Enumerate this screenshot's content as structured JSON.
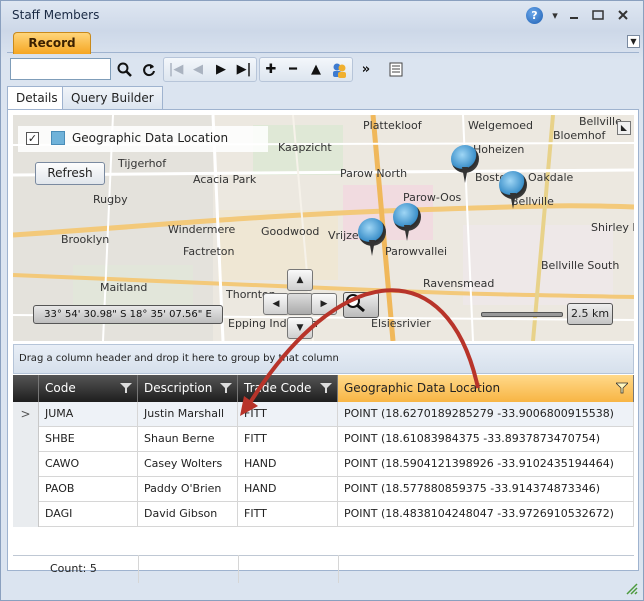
{
  "window": {
    "title": "Staff Members",
    "help_icon": "?"
  },
  "tabs": {
    "record_label": "Record"
  },
  "toolbar": {
    "search_value": ""
  },
  "subtabs": [
    {
      "label": "Details"
    },
    {
      "label": "Query Builder"
    }
  ],
  "map": {
    "layer_label": "Geographic Data Location",
    "layer_checked": true,
    "refresh_label": "Refresh",
    "coordinates": "33° 54' 30.98\" S 18° 35' 07.56\" E",
    "scale": "2.5 km",
    "places": [
      "Plattekloof",
      "Welgemoed",
      "Bellville",
      "Bloemhof",
      "Kaapzicht",
      "Hoheizen",
      "Tijgerhof",
      "Acacia Park",
      "Parow North",
      "Boston",
      "Oakdale",
      "Rugby",
      "Parow-Oos",
      "Bellville",
      "Shirley Park",
      "Brooklyn",
      "Windermere",
      "Goodwood",
      "Vrijzee",
      "Parowvallei",
      "Factreton",
      "Ravensmead",
      "Bellville South",
      "Maitland",
      "Thornton",
      "Elsiesrivier",
      "Epping Industria"
    ]
  },
  "grid": {
    "group_hint": "Drag a column header and drop it here to group by that column",
    "columns": [
      "Code",
      "Description",
      "Trade Code",
      "Geographic Data Location"
    ],
    "rows": [
      {
        "code": "JUMA",
        "description": "Justin Marshall",
        "trade": "FITT",
        "location": "POINT (18.6270189285279 -33.9006800915538)"
      },
      {
        "code": "SHBE",
        "description": "Shaun Berne",
        "trade": "FITT",
        "location": "POINT (18.61083984375 -33.8937873470754)"
      },
      {
        "code": "CAWO",
        "description": "Casey Wolters",
        "trade": "HAND",
        "location": "POINT (18.5904121398926 -33.9102435194464)"
      },
      {
        "code": "PAOB",
        "description": "Paddy O'Brien",
        "trade": "HAND",
        "location": "POINT (18.577880859375 -33.914374873346)"
      },
      {
        "code": "DAGI",
        "description": "David Gibson",
        "trade": "FITT",
        "location": "POINT (18.4838104248047 -33.9726910532672)"
      }
    ],
    "count_label": "Count: 5"
  },
  "colors": {
    "accent": "#f5a623",
    "selected_header": "#f8b544",
    "pin": "#3b8fc9",
    "arrow": "#c0392b"
  },
  "icons": [
    "help-icon",
    "search-icon",
    "refresh-icon",
    "first-icon",
    "prev-icon",
    "next-icon",
    "last-icon",
    "add-icon",
    "remove-icon",
    "up-icon",
    "users-icon",
    "fast-forward-icon",
    "calendar-icon",
    "filter-icon",
    "zoom-icon",
    "map-pin-icon"
  ]
}
